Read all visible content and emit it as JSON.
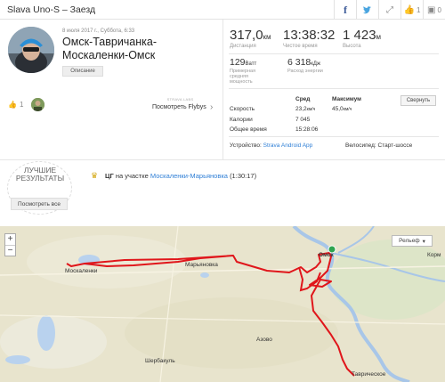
{
  "header": {
    "title": "Slava Uno-S – Заезд",
    "like_count": "1",
    "comment_count": "0"
  },
  "activity": {
    "date": "8 июля 2017 г., Суббота, 6:33",
    "title": "Омск-Тавричанка-Москаленки-Омск",
    "description_btn": "Описание"
  },
  "kudos": {
    "count": "1"
  },
  "flybys": {
    "labs": "STRAVA LABS",
    "label": "Посмотреть Flybys",
    "arrow": "›"
  },
  "stats": {
    "distance": {
      "value": "317,0",
      "unit": "км",
      "label": "Дистанция"
    },
    "moving_time": {
      "value": "13:38:32",
      "label": "Чистое время"
    },
    "elevation": {
      "value": "1 423",
      "unit": "м",
      "label": "Высота"
    },
    "power": {
      "value": "129",
      "unit": "Ватт",
      "label_1": "Примерная",
      "label_2": "средняя",
      "label_3": "мощность"
    },
    "energy": {
      "value": "6 318",
      "unit": "кДж",
      "label": "Расход энергии"
    }
  },
  "table": {
    "col_avg": "Сред",
    "col_max": "Максимум",
    "compare_btn": "Свернуть",
    "rows": [
      {
        "label": "Скорость",
        "avg": "23,2",
        "avg_unit": "км/ч",
        "max": "45,0",
        "max_unit": "км/ч"
      },
      {
        "label": "Калории",
        "avg": "7 045"
      },
      {
        "label": "Общее время",
        "avg": "15:28:06"
      }
    ]
  },
  "device": {
    "label": "Устройство:",
    "value": "Strava Android App"
  },
  "bike": {
    "label": "Велосипед:",
    "value": "Старт-шоссе"
  },
  "achievements": {
    "best_line1": "ЛУЧШИЕ",
    "best_line2": "РЕЗУЛЬТАТЫ",
    "see_all_btn": "Посмотреть все",
    "kom": "ЦГ",
    "on_segment": "на участке",
    "segment": "Москаленки-Марьяновка",
    "time": "(1:30:17)"
  },
  "map": {
    "zoom_in": "+",
    "zoom_out": "−",
    "layer_btn": "Рельеф",
    "labels": {
      "moskalenki": "Москаленки",
      "maryanovka": "Марьяновка",
      "omsk": "Омск",
      "azovo": "Азово",
      "sherbakul": "Шербакуль",
      "tavricheskoe": "Таврическое",
      "kormilovka": "Корм"
    }
  },
  "colors": {
    "accent": "#fc4c02",
    "link": "#2f7fd6",
    "route": "#e0161b",
    "map_bg": "#e9e5cf",
    "water": "#a8c6e8"
  }
}
